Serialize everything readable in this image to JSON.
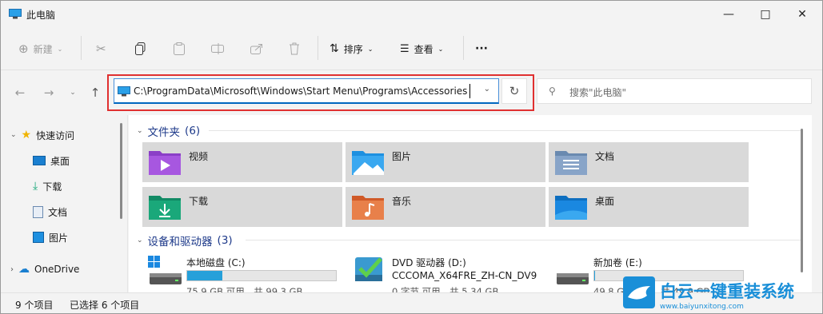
{
  "window": {
    "title": "此电脑"
  },
  "toolbar": {
    "new_label": "新建",
    "sort_label": "排序",
    "view_label": "查看",
    "more_label": "···"
  },
  "address": {
    "path": "C:\\ProgramData\\Microsoft\\Windows\\Start Menu\\Programs\\Accessories"
  },
  "search": {
    "placeholder": "搜索\"此电脑\""
  },
  "sidebar": {
    "items": [
      {
        "label": "快速访问"
      },
      {
        "label": "桌面"
      },
      {
        "label": "下载"
      },
      {
        "label": "文档"
      },
      {
        "label": "图片"
      },
      {
        "label": "OneDrive"
      }
    ]
  },
  "folders": {
    "header": "文件夹",
    "count": "(6)",
    "items": [
      {
        "label": "视频",
        "color": "#8b3fc7"
      },
      {
        "label": "图片",
        "color": "#1e90e0"
      },
      {
        "label": "文档",
        "color": "#6a8ab0"
      },
      {
        "label": "下载",
        "color": "#1aa87a"
      },
      {
        "label": "音乐",
        "color": "#e0703a"
      },
      {
        "label": "桌面",
        "color": "#1a7fd0"
      }
    ]
  },
  "drives": {
    "header": "设备和驱动器",
    "count": "(3)",
    "items": [
      {
        "name": "本地磁盘 (C:)",
        "capacity": "75.9 GB 可用，共 99.3 GB",
        "used_fraction": 0.236
      },
      {
        "name": "DVD 驱动器 (D:)",
        "subtitle": "CCCOMA_X64FRE_ZH-CN_DV9",
        "capacity": "0 字节 可用，共 5.34 GB"
      },
      {
        "name": "新加卷 (E:)",
        "capacity": "49.8 GB 可用，共 49.9 GB",
        "used_fraction": 0.002
      }
    ]
  },
  "status": {
    "count": "9 个项目",
    "selected": "已选择 6 个项目"
  },
  "watermark": {
    "title": "白云一键重装系统",
    "url": "www.baiyunxitong.com"
  },
  "colors": {
    "accent": "#0067c0",
    "highlight_box": "#e03030",
    "tile_bg": "#d9d9d9"
  }
}
